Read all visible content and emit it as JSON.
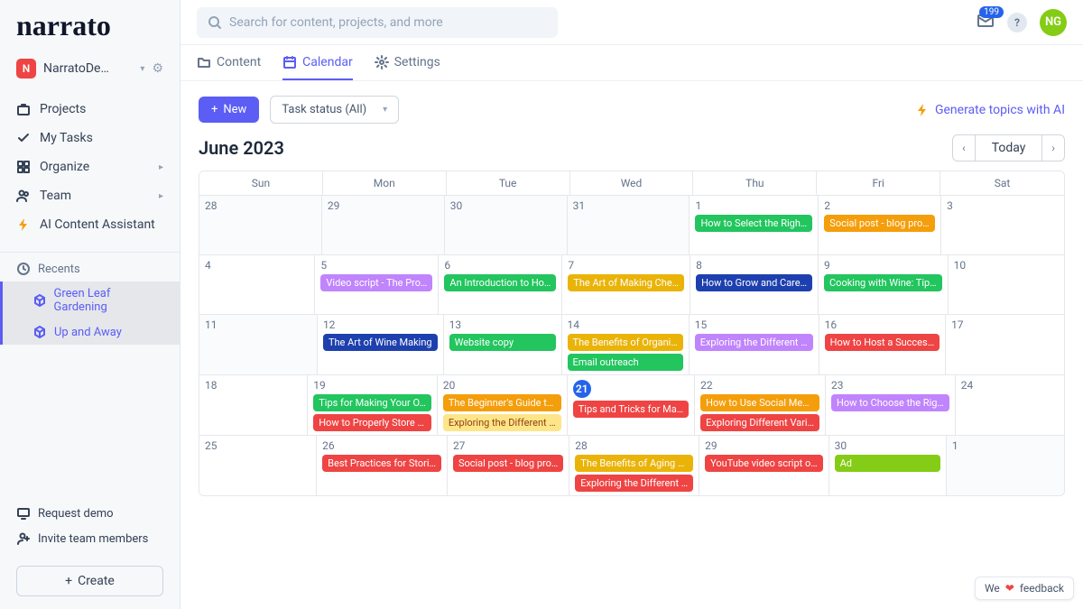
{
  "logo": "narrato",
  "workspace": {
    "initial": "N",
    "name": "NarratoDe…"
  },
  "nav": [
    {
      "icon": "briefcase",
      "label": "Projects"
    },
    {
      "icon": "check",
      "label": "My Tasks"
    },
    {
      "icon": "grid",
      "label": "Organize",
      "exp": true
    },
    {
      "icon": "users",
      "label": "Team",
      "exp": true
    },
    {
      "icon": "bolt",
      "label": "AI Content Assistant",
      "cls": "ai"
    }
  ],
  "recents": {
    "label": "Recents",
    "items": [
      "Green Leaf Gardening",
      "Up and Away"
    ]
  },
  "bottom": {
    "demo": "Request demo",
    "invite": "Invite team members",
    "create": "Create"
  },
  "search": {
    "placeholder": "Search for content, projects, and more"
  },
  "notif_count": "199",
  "avatar": "NG",
  "tabs": [
    {
      "icon": "folder",
      "label": "Content"
    },
    {
      "icon": "calendar",
      "label": "Calendar",
      "active": true
    },
    {
      "icon": "gear",
      "label": "Settings"
    }
  ],
  "new": "New",
  "filter": "Task status (All)",
  "gen": "Generate topics with AI",
  "month": "June 2023",
  "today": "Today",
  "dow": [
    "Sun",
    "Mon",
    "Tue",
    "Wed",
    "Thu",
    "Fri",
    "Sat"
  ],
  "weeks": [
    [
      {
        "n": "28",
        "out": true
      },
      {
        "n": "29",
        "out": true
      },
      {
        "n": "30",
        "out": true
      },
      {
        "n": "31",
        "out": true
      },
      {
        "n": "1",
        "ev": [
          {
            "t": "How to Select the Righ…",
            "c": "green"
          }
        ]
      },
      {
        "n": "2",
        "ev": [
          {
            "t": "Social post - blog pro…",
            "c": "dkyellow"
          }
        ]
      },
      {
        "n": "3"
      }
    ],
    [
      {
        "n": "4"
      },
      {
        "n": "5",
        "ev": [
          {
            "t": "Video script - The Pro…",
            "c": "purple"
          }
        ]
      },
      {
        "n": "6",
        "ev": [
          {
            "t": "An Introduction to Ho…",
            "c": "green"
          }
        ]
      },
      {
        "n": "7",
        "ev": [
          {
            "t": "The Art of Making Che…",
            "c": "mustard"
          }
        ]
      },
      {
        "n": "8",
        "ev": [
          {
            "t": "How to Grow and Care…",
            "c": "blue"
          }
        ]
      },
      {
        "n": "9",
        "ev": [
          {
            "t": "Cooking with Wine: Tip…",
            "c": "green"
          }
        ]
      },
      {
        "n": "10"
      }
    ],
    [
      {
        "n": "11",
        "out": true
      },
      {
        "n": "12",
        "ev": [
          {
            "t": "The Art of Wine Making",
            "c": "blue"
          }
        ]
      },
      {
        "n": "13",
        "ev": [
          {
            "t": "Website copy",
            "c": "green"
          }
        ]
      },
      {
        "n": "14",
        "ev": [
          {
            "t": "The Benefits of Organi…",
            "c": "mustard"
          },
          {
            "t": "Email outreach",
            "c": "green"
          }
        ]
      },
      {
        "n": "15",
        "ev": [
          {
            "t": "Exploring the Different …",
            "c": "purple"
          }
        ]
      },
      {
        "n": "16",
        "ev": [
          {
            "t": "How to Host a Succes…",
            "c": "red"
          }
        ]
      },
      {
        "n": "17"
      }
    ],
    [
      {
        "n": "18"
      },
      {
        "n": "19",
        "ev": [
          {
            "t": "Tips for Making Your O…",
            "c": "green"
          },
          {
            "t": "How to Properly Store …",
            "c": "red"
          }
        ]
      },
      {
        "n": "20",
        "ev": [
          {
            "t": "The Beginner's Guide t…",
            "c": "dkyellow"
          },
          {
            "t": "Exploring the Different …",
            "c": "lyellow"
          }
        ]
      },
      {
        "n": "21",
        "today": true,
        "ev": [
          {
            "t": "Tips and Tricks for Ma…",
            "c": "red"
          }
        ]
      },
      {
        "n": "22",
        "ev": [
          {
            "t": "How to Use Social Me…",
            "c": "dkyellow"
          },
          {
            "t": "Exploring Different Vari…",
            "c": "red"
          }
        ]
      },
      {
        "n": "23",
        "ev": [
          {
            "t": "How to Choose the Rig…",
            "c": "purple"
          }
        ]
      },
      {
        "n": "24"
      }
    ],
    [
      {
        "n": "25"
      },
      {
        "n": "26",
        "ev": [
          {
            "t": "Best Practices for Stori…",
            "c": "red"
          }
        ]
      },
      {
        "n": "27",
        "ev": [
          {
            "t": "Social post - blog pro…",
            "c": "red"
          }
        ]
      },
      {
        "n": "28",
        "ev": [
          {
            "t": "The Benefits of Aging …",
            "c": "mustard"
          },
          {
            "t": "Exploring the Different …",
            "c": "red"
          }
        ]
      },
      {
        "n": "29",
        "ev": [
          {
            "t": "YouTube video script o…",
            "c": "red"
          }
        ]
      },
      {
        "n": "30",
        "ev": [
          {
            "t": "Ad",
            "c": "olive"
          }
        ]
      },
      {
        "n": "1",
        "out": true
      }
    ]
  ],
  "feedback": {
    "pre": "We",
    "post": "feedback"
  }
}
